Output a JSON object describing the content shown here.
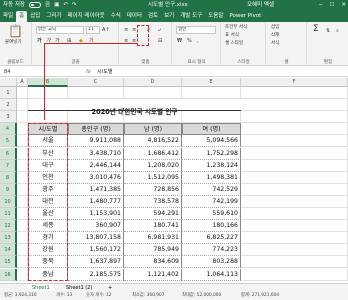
{
  "titlebar": {
    "autosave": "자동 저장",
    "autosave_state": "끔",
    "filename": "시도별 인구.xlsx",
    "user": "오혜미 엑셀",
    "user_initials": "OH"
  },
  "tabs": [
    "파일",
    "홈",
    "삽입",
    "그리기",
    "페이지 레이아웃",
    "수식",
    "데이터",
    "검토",
    "보기",
    "개발 도구",
    "도움말",
    "Power Pivot"
  ],
  "ribbon": {
    "paste": "붙여넣기",
    "font_name": "맑은 고딕",
    "font_size": "11",
    "number_format": "일반",
    "cond_format": "조건부 서식",
    "table_format": "표 서식",
    "cell_style": "셀 스타일",
    "insert": "삽입",
    "delete": "삭제",
    "format": "서식",
    "groups": {
      "clipboard": "클립보드",
      "font": "글꼴",
      "align": "맞춤",
      "number": "표시 형식",
      "style": "스타일",
      "cells": "셀",
      "edit": "편집"
    }
  },
  "formula_bar": {
    "name_box": "B4",
    "fx": "fx",
    "value": "시/도별"
  },
  "columns": [
    "A",
    "B",
    "C",
    "D",
    "E",
    "F"
  ],
  "rows": [
    "1",
    "2",
    "3",
    "4",
    "5",
    "6",
    "7",
    "8",
    "9",
    "10",
    "11",
    "12",
    "13",
    "14",
    "15",
    "16"
  ],
  "sheet": {
    "title": "2020년 대한민국 시도별 인구",
    "headers": [
      "시/도별",
      "총인구 (명)",
      "남 (명)",
      "여 (명)"
    ],
    "data": [
      [
        "서울",
        "9,911,088",
        "4,816,522",
        "5,094,566"
      ],
      [
        "부산",
        "3,438,710",
        "1,686,412",
        "1,752,298"
      ],
      [
        "대구",
        "2,446,144",
        "1,208,020",
        "1,238,124"
      ],
      [
        "인천",
        "3,010,476",
        "1,512,095",
        "1,498,381"
      ],
      [
        "광주",
        "1,471,385",
        "728,856",
        "742,529"
      ],
      [
        "대전",
        "1,480,777",
        "738,578",
        "742,199"
      ],
      [
        "울산",
        "1,153,901",
        "594,291",
        "559,610"
      ],
      [
        "세종",
        "360,907",
        "180,741",
        "180,166"
      ],
      [
        "경기",
        "13,807,158",
        "6,981,931",
        "6,825,227"
      ],
      [
        "강원",
        "1,560,172",
        "785,949",
        "774,223"
      ],
      [
        "충북",
        "1,637,897",
        "834,609",
        "803,288"
      ],
      [
        "충남",
        "2,185,575",
        "1,121,402",
        "1,064,113"
      ]
    ]
  },
  "sheet_tabs": [
    "Sheet1",
    "Sheet1 (2)",
    "+"
  ],
  "status": {
    "avg": "평균: 3,924,316",
    "count": "개수: 13",
    "num_count": "숫자 개수: 12",
    "min": "최소값: 360,907",
    "max": "최대값: 52,000,000",
    "sum": "합계: 271,921,604"
  },
  "colors": {
    "excel_green": "#217346",
    "highlight_red": "#e02020",
    "header_fill": "#d9d9d9"
  }
}
